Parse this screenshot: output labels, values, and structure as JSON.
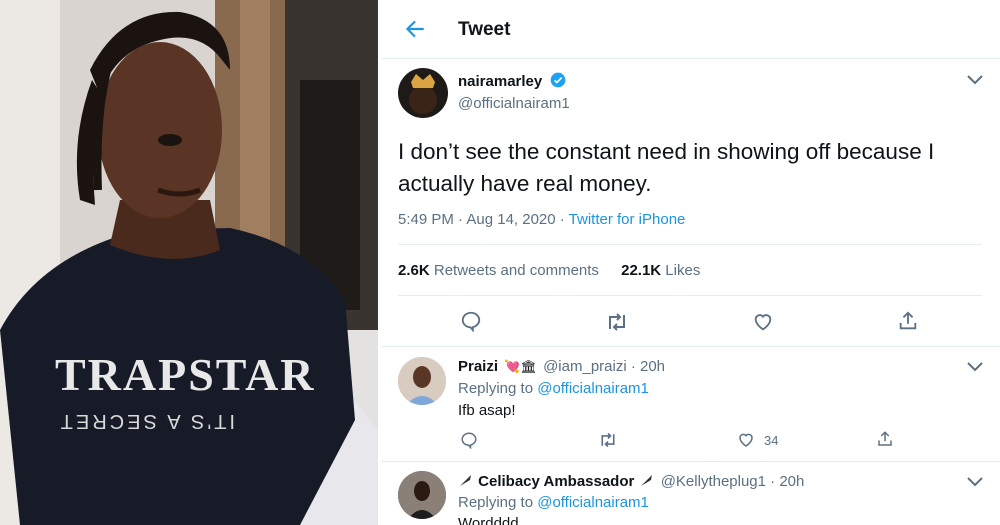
{
  "header": {
    "title": "Tweet"
  },
  "tweet": {
    "display_name": "nairamarley",
    "handle": "@officialnairam1",
    "text": "I don’t see the constant need in showing off because I actually have real money.",
    "time_date": "5:49 PM · Aug 14, 2020 · ",
    "source": "Twitter for iPhone",
    "retweets_count": "2.6K",
    "retweets_label": " Retweets and comments",
    "likes_count": "22.1K",
    "likes_label": " Likes"
  },
  "replies": [
    {
      "display_name": "Praizi",
      "emojis": "💘🏛",
      "handle": "@iam_praizi",
      "time": " · 20h",
      "replying_prefix": "Replying to ",
      "replying_handle": "@officialnairam1",
      "text": "Ifb asap!",
      "like_count": "34"
    },
    {
      "display_name": "Celibacy Ambassador",
      "handle": "@Kellytheplug1",
      "time": " · 20h",
      "replying_prefix": "Replying to ",
      "replying_handle": "@officialnairam1",
      "text": "Wordddd"
    }
  ],
  "photo": {
    "shirt_text": "TRAPSTAR",
    "shirt_subtext": "IT'S A SECRET"
  },
  "colors": {
    "accent": "#1b95e0",
    "verified": "#1da1f2",
    "muted": "#5b7083",
    "border": "#e6ecf0"
  }
}
